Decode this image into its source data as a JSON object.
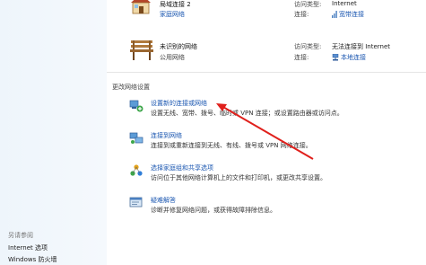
{
  "sidebar": {
    "see_also": "另请参阅",
    "links": [
      "Internet 选项",
      "Windows 防火墙"
    ]
  },
  "networks": [
    {
      "name": "局域连接 2",
      "type": "家庭网络",
      "access_label": "访问类型:",
      "access_value": "Internet",
      "conn_label": "连接:",
      "conn_value": "宽带连接",
      "icon": "house-icon"
    },
    {
      "name": "未识别的网络",
      "type": "公用网络",
      "access_label": "访问类型:",
      "access_value": "无法连接到 Internet",
      "conn_label": "连接:",
      "conn_value": "本地连接",
      "icon": "park-bench-icon"
    }
  ],
  "section_title": "更改网络设置",
  "tasks": [
    {
      "link": "设置新的连接或网络",
      "desc": "设置无线、宽带、拨号、临时或 VPN 连接；或设置路由器或访问点。",
      "icon": "network-setup-icon"
    },
    {
      "link": "连接到网络",
      "desc": "连接到或重新连接到无线、有线、拨号或 VPN 网络连接。",
      "icon": "connect-network-icon"
    },
    {
      "link": "选择家庭组和共享选项",
      "desc": "访问位于其他网络计算机上的文件和打印机，或更改共享设置。",
      "icon": "homegroup-icon"
    },
    {
      "link": "疑难解答",
      "desc": "诊断并修复网络问题，或获得故障排除信息。",
      "icon": "troubleshoot-icon"
    }
  ],
  "colors": {
    "link": "#1a56b0",
    "arrow": "#e0201c",
    "sidebar_bg": "#eef5fb"
  }
}
